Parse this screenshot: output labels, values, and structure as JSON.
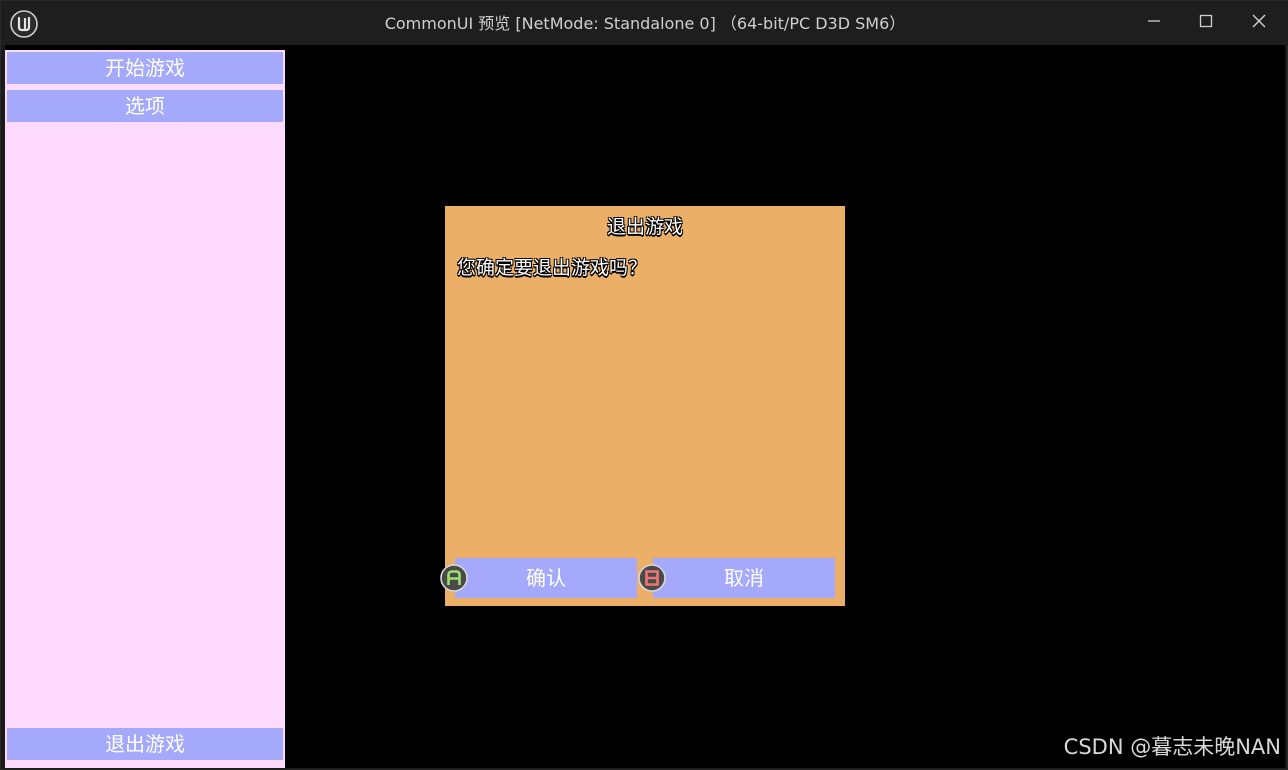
{
  "window": {
    "title": "CommonUI 预览 [NetMode: Standalone 0] （64-bit/PC D3D SM6）"
  },
  "titlebar_icons": {
    "app": "unreal-engine-logo-icon",
    "minimize": "minimize-icon",
    "maximize": "maximize-icon",
    "close": "close-icon"
  },
  "sidebar": {
    "background": "#fedbfe",
    "items": [
      {
        "label": "开始游戏"
      },
      {
        "label": "选项"
      }
    ],
    "bottom_item": {
      "label": "退出游戏"
    }
  },
  "dialog": {
    "background": "#ecaf68",
    "title": "退出游戏",
    "message": "您确定要退出游戏吗？",
    "confirm": {
      "label": "确认",
      "gamepad_key": "A"
    },
    "cancel": {
      "label": "取消",
      "gamepad_key": "B"
    }
  },
  "colors": {
    "button": "#a4a9fb",
    "viewport": "#000000",
    "gamepad_a": "#9be36a",
    "gamepad_b": "#f07474"
  },
  "watermark": "CSDN @暮志未晚NAN"
}
